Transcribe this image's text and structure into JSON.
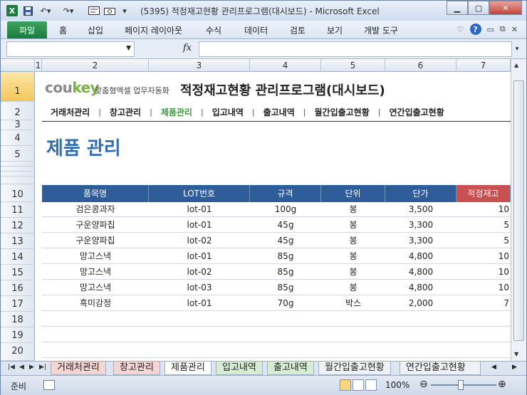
{
  "window": {
    "title": "(5395) 적정재고현황 관리프로그램(대시보드)  -  Microsoft Excel",
    "app_icon": "X"
  },
  "ribbon": {
    "file_tab": "파일",
    "tabs": [
      "홈",
      "삽입",
      "페이지 레이아웃",
      "수식",
      "데이터",
      "검토",
      "보기",
      "개발 도구"
    ]
  },
  "formula_bar": {
    "name_box": "",
    "fx_label": "fx",
    "formula": ""
  },
  "columns": [
    "1",
    "2",
    "3",
    "4",
    "5",
    "6",
    "7"
  ],
  "rows": [
    "1",
    "2",
    "3",
    "4",
    "5",
    "",
    "",
    "",
    "",
    "10",
    "11",
    "12",
    "13",
    "14",
    "15",
    "16",
    "17",
    "18",
    "19",
    "20"
  ],
  "sheet": {
    "brand_main": "cou",
    "brand_key": "key",
    "brand_sub": "맞춤형엑셀 업무자동화",
    "title": "적정재고현황 관리프로그램(대시보드)",
    "menu": [
      "거래처관리",
      "창고관리",
      "제품관리",
      "입고내역",
      "출고내역",
      "월간입출고현황",
      "연간입출고현황"
    ],
    "active_menu": "제품관리",
    "page_heading": "제품 관리",
    "table": {
      "headers": [
        "품목명",
        "LOT번호",
        "규격",
        "단위",
        "단가",
        "적정재고"
      ],
      "rows": [
        [
          "검은콩과자",
          "lot-01",
          "100g",
          "봉",
          "3,500",
          "10"
        ],
        [
          "구운양파칩",
          "lot-01",
          "45g",
          "봉",
          "3,300",
          "5"
        ],
        [
          "구운양파칩",
          "lot-02",
          "45g",
          "봉",
          "3,300",
          "5"
        ],
        [
          "망고스낵",
          "lot-01",
          "85g",
          "봉",
          "4,800",
          "10"
        ],
        [
          "망고스낵",
          "lot-02",
          "85g",
          "봉",
          "4,800",
          "10"
        ],
        [
          "망고스낵",
          "lot-03",
          "85g",
          "봉",
          "4,800",
          "10"
        ],
        [
          "흑미강정",
          "lot-01",
          "70g",
          "박스",
          "2,000",
          "7"
        ]
      ]
    }
  },
  "sheet_tabs": [
    "거래처관리",
    "창고관리",
    "제품관리",
    "입고내역",
    "출고내역",
    "월간입출고현황",
    "연간입출고현황"
  ],
  "active_sheet": "제품관리",
  "status": {
    "ready": "준비",
    "zoom": "100%"
  },
  "colors": {
    "header_blue": "#2f5d99",
    "header_red": "#c95050",
    "heading_blue": "#2e6db2",
    "active_menu_green": "#3c9b3c",
    "file_tab_green": "#1e7a3d"
  }
}
